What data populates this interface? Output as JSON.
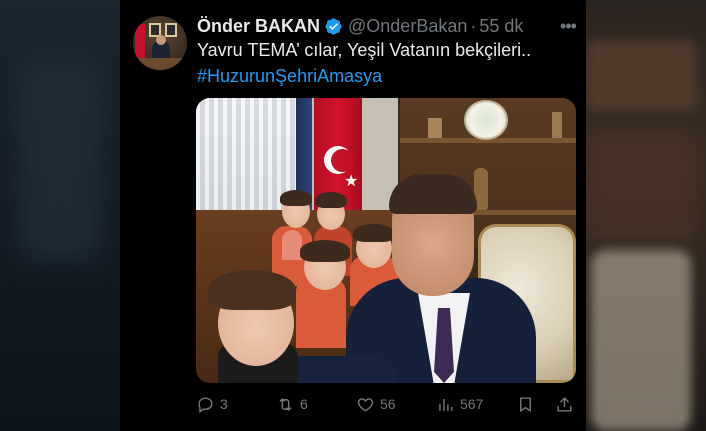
{
  "tweet": {
    "author_name": "Önder BAKAN",
    "handle": "@OnderBakan",
    "separator": "·",
    "time": "55 dk",
    "text_line1": "Yavru TEMA’ cılar,  Yeşil Vatanın bekçileri..",
    "text_line2": "#HuzurunŞehriAmasya",
    "more_label": "•••",
    "verified_color": "#1d9bf0",
    "link_color": "#1d9bf0"
  },
  "actions": {
    "replies": "3",
    "retweets": "6",
    "likes": "56",
    "views": "567"
  },
  "icons": {
    "reply": "reply-icon",
    "retweet": "retweet-icon",
    "like": "heart-icon",
    "views": "views-icon",
    "bookmark": "bookmark-icon",
    "share": "share-icon"
  }
}
